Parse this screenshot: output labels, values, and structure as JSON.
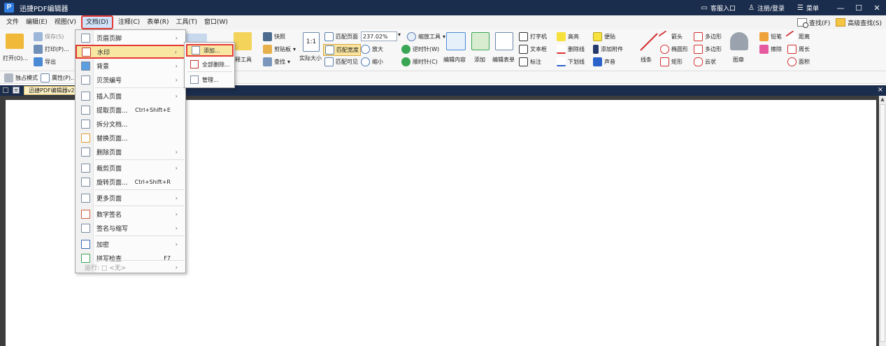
{
  "app": {
    "logo_letter": "P",
    "title": "迅捷PDF编辑器"
  },
  "titlebar": {
    "service": "客服入口",
    "login": "注册/登录",
    "menu": "菜单",
    "minimize": "—",
    "restore": "☐",
    "close": "✕"
  },
  "menubar": {
    "items": [
      "文件",
      "编辑(E)",
      "视图(V)",
      "文档(D)",
      "注释(C)",
      "表单(R)",
      "工具(T)",
      "窗口(W)"
    ],
    "find": "查找(F)",
    "advanced_find": "高级查找(S)"
  },
  "ribbon": {
    "open": "打开(O)...",
    "save": "保存(S)",
    "print": "打印(P)...",
    "export": "导出",
    "exclusive_mode": "独占模式",
    "properties": "属性(P)...",
    "snapshot": "快照",
    "clipboard": "剪贴板",
    "find": "查找",
    "annotate_tool": "注释工具",
    "actual_size": "实际大小",
    "actual_size_badge": "1:1",
    "fit_page": "匹配页面",
    "fit_width": "匹配宽度",
    "fit_visible": "匹配可见",
    "zoom_value": "237.02%",
    "zoom_tool": "缩放工具",
    "zoom_in": "放大",
    "zoom_out": "缩小",
    "rotate_ccw": "逆时针(W)",
    "rotate_cw": "顺时针(C)",
    "edit_content": "编辑内容",
    "add": "添加",
    "edit_form": "编辑表单",
    "typewriter": "打字机",
    "textbox": "文本框",
    "callout": "标注",
    "highlight": "高亮",
    "strikeout": "删除线",
    "underline": "下划线",
    "note": "便贴",
    "attach_file": "添加附件",
    "sound": "声音",
    "line": "线条",
    "arrow": "箭头",
    "ellipse": "椭圆形",
    "rectangle": "矩形",
    "polygon1": "多边形",
    "polygon2": "多边形",
    "cloud": "云状",
    "stamp": "图章",
    "pencil": "铅笔",
    "eraser": "擦除",
    "distance": "距离",
    "perimeter": "周长",
    "area": "面积"
  },
  "tab": {
    "name": "迅捷PDF编辑器v2.0",
    "close": "×"
  },
  "dropdown": {
    "items": [
      {
        "label": "页眉页脚",
        "shortcut": "",
        "arrow": "›"
      },
      {
        "label": "水印",
        "shortcut": "",
        "arrow": "›"
      },
      {
        "label": "背景",
        "shortcut": "",
        "arrow": "›"
      },
      {
        "label": "贝茨编号",
        "shortcut": "",
        "arrow": "›"
      },
      {
        "label": "插入页面",
        "shortcut": "",
        "arrow": "›"
      },
      {
        "label": "提取页面...",
        "shortcut": "Ctrl+Shift+E",
        "arrow": ""
      },
      {
        "label": "拆分文档...",
        "shortcut": "",
        "arrow": ""
      },
      {
        "label": "替换页面...",
        "shortcut": "",
        "arrow": ""
      },
      {
        "label": "删除页面",
        "shortcut": "",
        "arrow": "›"
      },
      {
        "label": "裁剪页面",
        "shortcut": "",
        "arrow": "›"
      },
      {
        "label": "旋转页面...",
        "shortcut": "Ctrl+Shift+R",
        "arrow": ""
      },
      {
        "label": "更多页面",
        "shortcut": "",
        "arrow": "›"
      },
      {
        "label": "数字签名",
        "shortcut": "",
        "arrow": "›"
      },
      {
        "label": "签名与缩写",
        "shortcut": "",
        "arrow": "›"
      },
      {
        "label": "加密",
        "shortcut": "",
        "arrow": "›"
      },
      {
        "label": "拼写检查",
        "shortcut": "F7",
        "arrow": ""
      },
      {
        "label": "运行: □ <无>",
        "shortcut": "",
        "arrow": "›"
      }
    ]
  },
  "submenu": {
    "items": [
      {
        "label": "添加..."
      },
      {
        "label": "全部删除..."
      },
      {
        "label": "管理..."
      }
    ]
  }
}
